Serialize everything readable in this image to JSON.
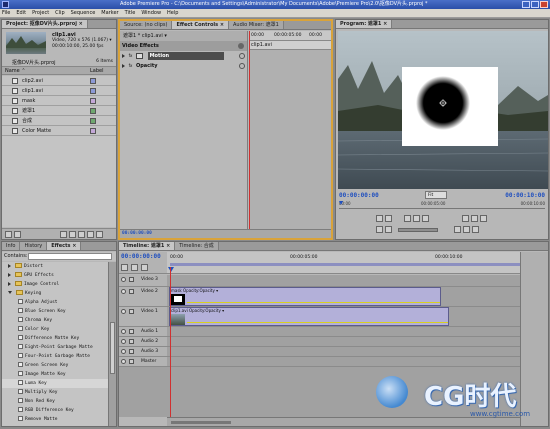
{
  "window": {
    "title": "Adobe Premiere Pro - C:\\Documents and Settings\\Administrator\\My Documents\\Adobe\\Premiere Pro\\2.0\\抠像DV片头.prproj *",
    "menu": [
      "File",
      "Edit",
      "Project",
      "Clip",
      "Sequence",
      "Marker",
      "Title",
      "Window",
      "Help"
    ]
  },
  "project": {
    "tab": "Project: 抠像DV片头.prproj ×",
    "clip_name": "clip1.avi",
    "clip_info1": "Video, 720 x 576 (1.067) ▾",
    "clip_info2": "00:00:10:00, 25.00 fps",
    "project_file": "抠像DV片头.prproj",
    "items_count": "6 Items",
    "col_name": "Name ⌃",
    "col_label": "Label",
    "items": [
      {
        "name": "clip2.avi",
        "type": "video"
      },
      {
        "name": "clip1.avi",
        "type": "video"
      },
      {
        "name": "mask",
        "type": "still"
      },
      {
        "name": "遮罩1",
        "type": "seq"
      },
      {
        "name": "合成",
        "type": "seq"
      },
      {
        "name": "Color Matte",
        "type": "matte"
      }
    ],
    "label_colors": [
      "#8d9ad6",
      "#8d9ad6",
      "#c4a8d8",
      "#6fa86f",
      "#6fa86f",
      "#c4a8d8"
    ]
  },
  "effect_controls": {
    "tabs": [
      "Source: (no clips)",
      "Effect Controls ×",
      "Audio Mixer: 遮罩1"
    ],
    "active_tab": 1,
    "header": "遮罩1 * clip1.avi ▾",
    "section": "Video Effects",
    "effects": [
      "Motion",
      "Opacity"
    ],
    "fx": "fx",
    "timecodes": [
      "00:00",
      "00:00:05:00",
      "00:00"
    ],
    "clip_label": "clip1.avi",
    "footer_timecode": "00:00:00:00"
  },
  "program": {
    "tab": "Program: 遮罩1 ×",
    "timecode_left": "00:00:00:00",
    "fit_label": "Fit",
    "timecode_right": "00:00:10:00",
    "ruler_start": "00:00",
    "ruler_mid": "00:00:05:00",
    "ruler_end": "00:00:10:00"
  },
  "effects_panel": {
    "tabs": [
      "Info",
      "History",
      "Effects ×"
    ],
    "active_tab": 2,
    "search_label": "Contains:",
    "items": [
      {
        "label": "Distort",
        "kind": "folder",
        "depth": 1
      },
      {
        "label": "GPU Effects",
        "kind": "folder",
        "depth": 1
      },
      {
        "label": "Image Control",
        "kind": "folder",
        "depth": 1
      },
      {
        "label": "Keying",
        "kind": "folder",
        "depth": 1,
        "open": true
      },
      {
        "label": "Alpha Adjust",
        "kind": "fx",
        "depth": 2
      },
      {
        "label": "Blue Screen Key",
        "kind": "fx",
        "depth": 2
      },
      {
        "label": "Chroma Key",
        "kind": "fx",
        "depth": 2
      },
      {
        "label": "Color Key",
        "kind": "fx",
        "depth": 2
      },
      {
        "label": "Difference Matte Key",
        "kind": "fx",
        "depth": 2
      },
      {
        "label": "Eight-Point Garbage Matte",
        "kind": "fx",
        "depth": 2
      },
      {
        "label": "Four-Point Garbage Matte",
        "kind": "fx",
        "depth": 2
      },
      {
        "label": "Green Screen Key",
        "kind": "fx",
        "depth": 2
      },
      {
        "label": "Image Matte Key",
        "kind": "fx",
        "depth": 2
      },
      {
        "label": "Luma Key",
        "kind": "fx",
        "depth": 2,
        "selected": true
      },
      {
        "label": "Multiply Key",
        "kind": "fx",
        "depth": 2
      },
      {
        "label": "Non Red Key",
        "kind": "fx",
        "depth": 2
      },
      {
        "label": "RGB Difference Key",
        "kind": "fx",
        "depth": 2
      },
      {
        "label": "Remove Matte",
        "kind": "fx",
        "depth": 2
      }
    ]
  },
  "timeline": {
    "tabs": [
      "Timeline: 遮罩1 ×",
      "Timeline: 合成"
    ],
    "active_tab": 0,
    "timecode": "00:00:00:00",
    "ruler": [
      "00:00",
      "00:00:05:00",
      "00:00:10:00"
    ],
    "tracks": [
      {
        "name": "Video 3",
        "kind": "video"
      },
      {
        "name": "Video 2",
        "kind": "video",
        "clip": "mask Opacity:Opacity ▾"
      },
      {
        "name": "Video 1",
        "kind": "video",
        "clip": "clip1.avi Opacity:Opacity ▾"
      },
      {
        "name": "Audio 1",
        "kind": "audio"
      },
      {
        "name": "Audio 2",
        "kind": "audio"
      },
      {
        "name": "Audio 3",
        "kind": "audio"
      },
      {
        "name": "Master",
        "kind": "master"
      }
    ]
  },
  "watermark": {
    "logo_text": "CG时代",
    "url": "www.cgtime.com"
  },
  "colors": {
    "accent_timecode": "#1f4fbf",
    "highlight_tab": "#d9a33a",
    "playhead": "#d03030",
    "clip_fill": "#b3b0d9"
  }
}
